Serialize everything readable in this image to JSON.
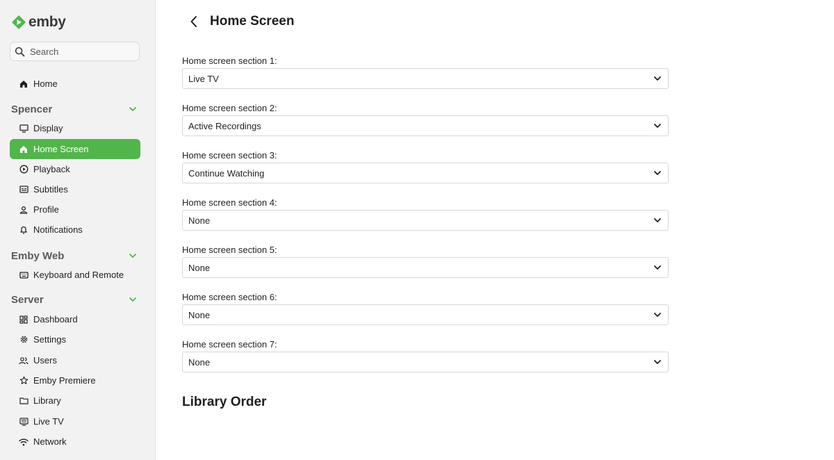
{
  "app": {
    "logo_text": "emby",
    "brand_color": "#52b54b"
  },
  "search": {
    "placeholder": "Search"
  },
  "sidebar": {
    "home": {
      "label": "Home",
      "icon": "home-icon"
    },
    "sections": [
      {
        "title": "Spencer",
        "items": [
          {
            "label": "Display",
            "icon": "monitor-icon"
          },
          {
            "label": "Home Screen",
            "icon": "home-icon",
            "active": true
          },
          {
            "label": "Playback",
            "icon": "play-circle-icon"
          },
          {
            "label": "Subtitles",
            "icon": "subtitles-icon"
          },
          {
            "label": "Profile",
            "icon": "person-icon"
          },
          {
            "label": "Notifications",
            "icon": "bell-icon"
          }
        ]
      },
      {
        "title": "Emby Web",
        "items": [
          {
            "label": "Keyboard and Remote",
            "icon": "keyboard-icon"
          }
        ]
      },
      {
        "title": "Server",
        "items": [
          {
            "label": "Dashboard",
            "icon": "dashboard-icon"
          },
          {
            "label": "Settings",
            "icon": "gear-icon"
          },
          {
            "label": "Users",
            "icon": "users-icon"
          },
          {
            "label": "Emby Premiere",
            "icon": "star-icon"
          },
          {
            "label": "Library",
            "icon": "folder-icon"
          },
          {
            "label": "Live TV",
            "icon": "tv-guide-icon"
          },
          {
            "label": "Network",
            "icon": "wifi-icon"
          }
        ]
      }
    ]
  },
  "main": {
    "title": "Home Screen",
    "sections": [
      {
        "label": "Home screen section 1:",
        "value": "Live TV"
      },
      {
        "label": "Home screen section 2:",
        "value": "Active Recordings"
      },
      {
        "label": "Home screen section 3:",
        "value": "Continue Watching"
      },
      {
        "label": "Home screen section 4:",
        "value": "None"
      },
      {
        "label": "Home screen section 5:",
        "value": "None"
      },
      {
        "label": "Home screen section 6:",
        "value": "None"
      },
      {
        "label": "Home screen section 7:",
        "value": "None"
      }
    ],
    "library_order_title": "Library Order"
  }
}
